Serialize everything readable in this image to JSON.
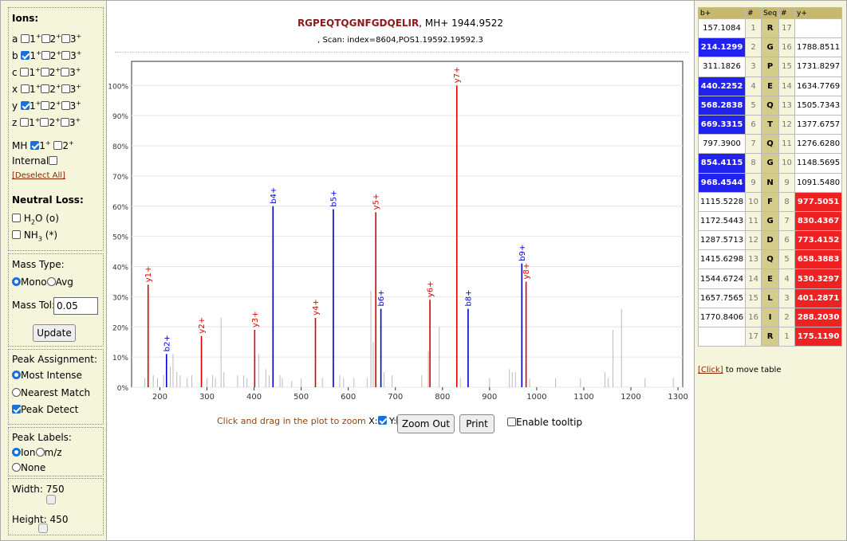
{
  "ions_panel": {
    "title": "Ions:",
    "rows": [
      {
        "letter": "a",
        "c1": false,
        "c2": false,
        "c3": false
      },
      {
        "letter": "b",
        "c1": true,
        "c2": false,
        "c3": false
      },
      {
        "letter": "c",
        "c1": false,
        "c2": false,
        "c3": false
      },
      {
        "letter": "x",
        "c1": false,
        "c2": false,
        "c3": false
      },
      {
        "letter": "y",
        "c1": true,
        "c2": false,
        "c3": false
      },
      {
        "letter": "z",
        "c1": false,
        "c2": false,
        "c3": false
      }
    ],
    "mh_label": "MH",
    "internal_label": "Internal",
    "deselect_all": "[Deselect All]",
    "neutral_loss_title": "Neutral Loss:",
    "h2o_label": "H",
    "h2o_sub": "2",
    "h2o_rest": "O (o)",
    "nh3_label": "NH",
    "nh3_sub": "3",
    "nh3_rest": " (*)"
  },
  "mass_panel": {
    "mass_type_title": "Mass Type:",
    "mono": "Mono",
    "avg": "Avg",
    "mass_tol_label": "Mass Tol:",
    "mass_tol_value": "0.05",
    "update": "Update"
  },
  "peak_panel": {
    "title": "Peak Assignment:",
    "most_intense": "Most Intense",
    "nearest_match": "Nearest Match",
    "peak_detect": "Peak Detect",
    "labels_title": "Peak Labels:",
    "ion": "Ion",
    "mz": "m/z",
    "none": "None",
    "width_label": "Width:",
    "width_value": "750",
    "height_label": "Height:",
    "height_value": "450"
  },
  "header": {
    "sequence": "RGPEQTQGNFGDQELIR",
    "mh": ", MH+ 1944.9522",
    "scan": ", Scan: index=8604,POS1.19592.19592.3"
  },
  "controls": {
    "zoom_hint": "Click and drag in the plot to zoom",
    "x_label": "X:",
    "y_label": "Y:",
    "zoom_out": "Zoom Out",
    "print": "Print",
    "tooltip": "Enable tooltip"
  },
  "chart_data": {
    "type": "bar",
    "xlim": [
      140,
      1310
    ],
    "ylim": [
      0,
      108
    ],
    "xticks": [
      "200",
      "300",
      "400",
      "500",
      "600",
      "700",
      "800",
      "900",
      "1000",
      "1100",
      "1200",
      "1300"
    ],
    "yticks": [
      "0%",
      "10%",
      "20%",
      "30%",
      "40%",
      "50%",
      "60%",
      "70%",
      "80%",
      "90%",
      "100%"
    ],
    "colors": {
      "b": "#0000cc",
      "y": "#dd0000",
      "other": "#bbbbbb"
    },
    "labeled_peaks": [
      {
        "label": "y1+",
        "mz": 175.1,
        "intensity": 34,
        "type": "y"
      },
      {
        "label": "b2+",
        "mz": 214.1,
        "intensity": 11,
        "type": "b"
      },
      {
        "label": "y2+",
        "mz": 288.2,
        "intensity": 17,
        "type": "y"
      },
      {
        "label": "y3+",
        "mz": 401.3,
        "intensity": 19,
        "type": "y"
      },
      {
        "label": "b4+",
        "mz": 440.2,
        "intensity": 60,
        "type": "b"
      },
      {
        "label": "y4+",
        "mz": 530.3,
        "intensity": 23,
        "type": "y"
      },
      {
        "label": "b5+",
        "mz": 568.3,
        "intensity": 59,
        "type": "b"
      },
      {
        "label": "y5+",
        "mz": 658.4,
        "intensity": 58,
        "type": "y"
      },
      {
        "label": "b6+",
        "mz": 669.3,
        "intensity": 26,
        "type": "b"
      },
      {
        "label": "y6+",
        "mz": 773.4,
        "intensity": 29,
        "type": "y"
      },
      {
        "label": "y7+",
        "mz": 830.4,
        "intensity": 100,
        "type": "y"
      },
      {
        "label": "b8+",
        "mz": 854.4,
        "intensity": 26,
        "type": "b"
      },
      {
        "label": "b9+",
        "mz": 968.5,
        "intensity": 41,
        "type": "b"
      },
      {
        "label": "y8+",
        "mz": 977.5,
        "intensity": 35,
        "type": "y"
      }
    ],
    "other_peaks": [
      [
        168,
        3
      ],
      [
        186,
        4
      ],
      [
        195,
        3
      ],
      [
        208,
        4
      ],
      [
        222,
        7
      ],
      [
        228,
        11
      ],
      [
        236,
        5
      ],
      [
        243,
        4
      ],
      [
        258,
        3
      ],
      [
        268,
        4
      ],
      [
        300,
        3
      ],
      [
        312,
        4
      ],
      [
        318,
        3
      ],
      [
        330,
        23
      ],
      [
        336,
        5
      ],
      [
        365,
        4
      ],
      [
        378,
        4
      ],
      [
        385,
        3
      ],
      [
        410,
        11
      ],
      [
        425,
        6
      ],
      [
        432,
        4
      ],
      [
        455,
        4
      ],
      [
        460,
        3
      ],
      [
        480,
        2
      ],
      [
        500,
        3
      ],
      [
        545,
        3
      ],
      [
        582,
        4
      ],
      [
        590,
        3
      ],
      [
        612,
        3
      ],
      [
        640,
        3
      ],
      [
        648,
        32
      ],
      [
        653,
        15
      ],
      [
        658,
        41
      ],
      [
        676,
        5
      ],
      [
        693,
        4
      ],
      [
        756,
        4
      ],
      [
        770,
        12
      ],
      [
        793,
        20
      ],
      [
        838,
        3
      ],
      [
        900,
        3
      ],
      [
        942,
        6
      ],
      [
        948,
        5
      ],
      [
        955,
        5
      ],
      [
        985,
        3
      ],
      [
        1040,
        3
      ],
      [
        1093,
        3
      ],
      [
        1145,
        5
      ],
      [
        1152,
        3
      ],
      [
        1162,
        19
      ],
      [
        1180,
        26
      ],
      [
        1230,
        3
      ],
      [
        1290,
        3
      ]
    ]
  },
  "fragment_table": {
    "headers": [
      "b+",
      "#",
      "Seq",
      "#",
      "y+"
    ],
    "rows": [
      {
        "b": "157.1084",
        "bhit": false,
        "n": "1",
        "aa": "R",
        "m": "17",
        "y": "",
        "yhit": false
      },
      {
        "b": "214.1299",
        "bhit": true,
        "n": "2",
        "aa": "G",
        "m": "16",
        "y": "1788.8511",
        "yhit": false
      },
      {
        "b": "311.1826",
        "bhit": false,
        "n": "3",
        "aa": "P",
        "m": "15",
        "y": "1731.8297",
        "yhit": false
      },
      {
        "b": "440.2252",
        "bhit": true,
        "n": "4",
        "aa": "E",
        "m": "14",
        "y": "1634.7769",
        "yhit": false
      },
      {
        "b": "568.2838",
        "bhit": true,
        "n": "5",
        "aa": "Q",
        "m": "13",
        "y": "1505.7343",
        "yhit": false
      },
      {
        "b": "669.3315",
        "bhit": true,
        "n": "6",
        "aa": "T",
        "m": "12",
        "y": "1377.6757",
        "yhit": false
      },
      {
        "b": "797.3900",
        "bhit": false,
        "n": "7",
        "aa": "Q",
        "m": "11",
        "y": "1276.6280",
        "yhit": false
      },
      {
        "b": "854.4115",
        "bhit": true,
        "n": "8",
        "aa": "G",
        "m": "10",
        "y": "1148.5695",
        "yhit": false
      },
      {
        "b": "968.4544",
        "bhit": true,
        "n": "9",
        "aa": "N",
        "m": "9",
        "y": "1091.5480",
        "yhit": false
      },
      {
        "b": "1115.5228",
        "bhit": false,
        "n": "10",
        "aa": "F",
        "m": "8",
        "y": "977.5051",
        "yhit": true
      },
      {
        "b": "1172.5443",
        "bhit": false,
        "n": "11",
        "aa": "G",
        "m": "7",
        "y": "830.4367",
        "yhit": true
      },
      {
        "b": "1287.5713",
        "bhit": false,
        "n": "12",
        "aa": "D",
        "m": "6",
        "y": "773.4152",
        "yhit": true
      },
      {
        "b": "1415.6298",
        "bhit": false,
        "n": "13",
        "aa": "Q",
        "m": "5",
        "y": "658.3883",
        "yhit": true
      },
      {
        "b": "1544.6724",
        "bhit": false,
        "n": "14",
        "aa": "E",
        "m": "4",
        "y": "530.3297",
        "yhit": true
      },
      {
        "b": "1657.7565",
        "bhit": false,
        "n": "15",
        "aa": "L",
        "m": "3",
        "y": "401.2871",
        "yhit": true
      },
      {
        "b": "1770.8406",
        "bhit": false,
        "n": "16",
        "aa": "I",
        "m": "2",
        "y": "288.2030",
        "yhit": true
      },
      {
        "b": "",
        "bhit": false,
        "n": "17",
        "aa": "R",
        "m": "1",
        "y": "175.1190",
        "yhit": true
      }
    ],
    "click_link": "[Click]",
    "click_text": " to move table"
  }
}
